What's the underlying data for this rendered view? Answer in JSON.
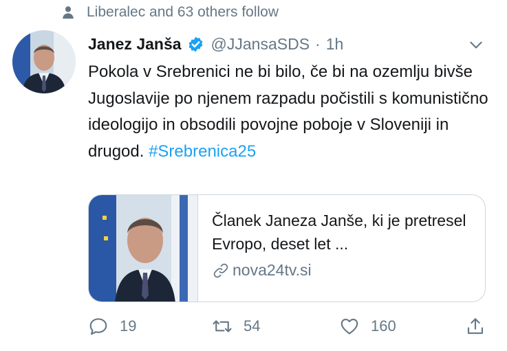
{
  "social_context": {
    "text": "Liberalec and 63 others follow",
    "icon": "person-icon"
  },
  "author": {
    "name": "Janez Janša",
    "verified_icon": "verified-badge-icon",
    "handle": "@JJansaSDS",
    "separator": "·",
    "time": "1h",
    "menu_icon": "chevron-down-icon"
  },
  "tweet": {
    "text": "Pokola v Srebrenici ne bi bilo, če bi na ozemlju bivše Jugoslavije po njenem razpadu počistili s komunistično ideologijo in obsodili povojne poboje v Sloveniji in drugod.",
    "hashtag": "#Srebrenica25"
  },
  "card": {
    "title": "Članek Janeza Janše, ki je pretresel Evropo, deset let ...",
    "domain": "nova24tv.si",
    "link_icon": "link-icon"
  },
  "actions": {
    "reply_count": "19",
    "retweet_count": "54",
    "like_count": "160",
    "share_icon": "share-icon"
  },
  "colors": {
    "accent": "#1da1f2",
    "secondary_text": "#657786",
    "border": "#ccd6dd"
  }
}
